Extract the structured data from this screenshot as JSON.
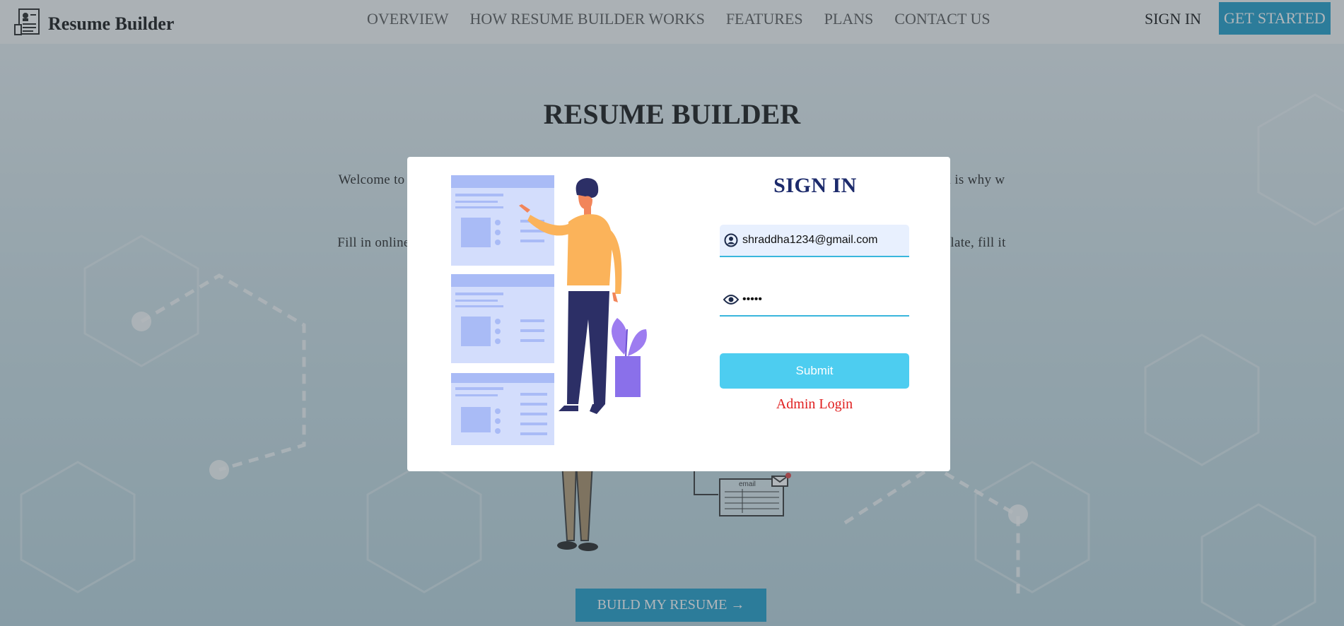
{
  "navbar": {
    "brand": "Resume Builder",
    "links": [
      "OVERVIEW",
      "HOW RESUME BUILDER WORKS",
      "FEATURES",
      "PLANS",
      "CONTACT US"
    ],
    "signin": "SIGN IN",
    "get_started": "GET STARTED",
    "brand_icon": "resume-document-icon"
  },
  "hero": {
    "title": "RESUME BUILDER",
    "para1": "Welcome to our resu                                                                                            n be a challenging task, which is why w                                                                                            and tools to make",
    "para2": "Fill in online, and dov                                                                                           et the job. Choose a CV template, fill it                                                                                            t pick one of the",
    "build_button": "BUILD MY RESUME →"
  },
  "modal": {
    "title": "SIGN IN",
    "email_value": "shraddha1234@gmail.com",
    "password_value": "•••••",
    "submit": "Submit",
    "admin_link": "Admin Login"
  },
  "colors": {
    "accent": "#1a9cc8",
    "modal_title": "#1c2a6b",
    "submit_bg": "#4dcdf0",
    "admin_link": "#e01e1e"
  }
}
